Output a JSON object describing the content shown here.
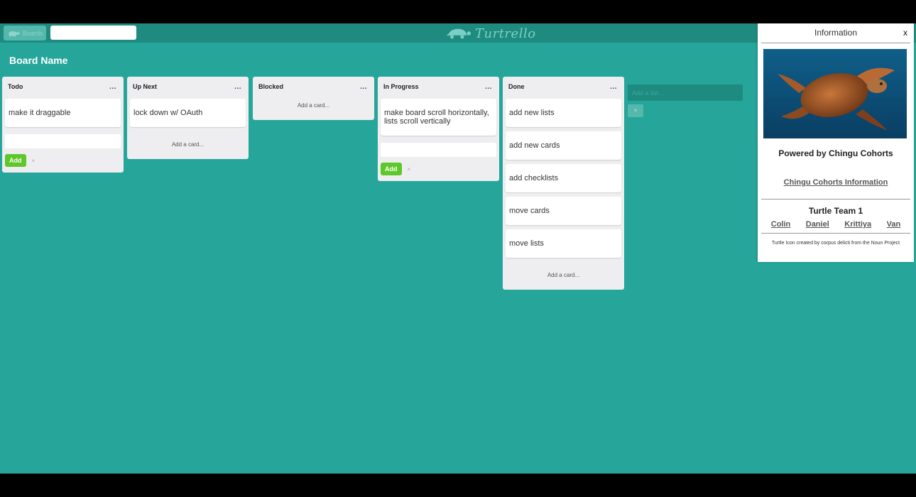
{
  "topbar": {
    "boards_label": "Boards",
    "search_value": "",
    "logo_text": "Turtrello"
  },
  "board": {
    "title": "Board Name"
  },
  "lists": [
    {
      "title": "Todo",
      "menu": "...",
      "cards": [
        "make it draggable"
      ],
      "composer": {
        "add_label": "Add",
        "cancel": "×"
      }
    },
    {
      "title": "Up Next",
      "menu": "...",
      "cards": [
        "lock down w/ OAuth"
      ],
      "add_card": "Add a card..."
    },
    {
      "title": "Blocked",
      "menu": "...",
      "cards": [],
      "add_card": "Add a card..."
    },
    {
      "title": "In Progress",
      "menu": "...",
      "cards": [
        "make board scroll horizontally, lists scroll vertically"
      ],
      "composer": {
        "add_label": "Add",
        "cancel": "×"
      }
    },
    {
      "title": "Done",
      "menu": "...",
      "cards": [
        "add new lists",
        "add new cards",
        "add checklists",
        "move cards",
        "move lists"
      ],
      "add_card": "Add a card..."
    }
  ],
  "add_list": {
    "placeholder": "Add a list...",
    "cancel": "×"
  },
  "info_panel": {
    "title": "Information",
    "close": "x",
    "powered_by": "Powered by Chingu Cohorts",
    "link": "Chingu Cohorts Information",
    "team": "Turtle Team 1",
    "members": [
      "Colin",
      "Daniel",
      "Krittiya",
      "Van"
    ],
    "credit": "Turtle Icon created by corpus delicti from the Noun Project"
  },
  "colors": {
    "board_bg": "#26a69a",
    "topbar_bg": "#1f8b80",
    "add_button": "#5ec72b"
  }
}
